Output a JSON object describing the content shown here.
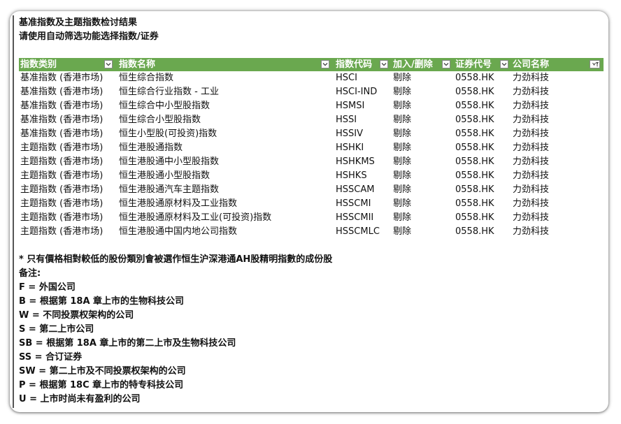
{
  "sheet": {
    "title": "基准指数及主题指数检讨结果",
    "subtitle": "请使用自动筛选功能选择指数/证券"
  },
  "table": {
    "headers": [
      "指数类别",
      "指数名称",
      "指数代码",
      "加入/删除",
      "证券代号",
      "公司名称"
    ],
    "rows": [
      [
        "基准指数 (香港市场)",
        "恒生综合指数",
        "HSCI",
        "剔除",
        "0558.HK",
        "力劲科技"
      ],
      [
        "基准指数 (香港市场)",
        "恒生综合行业指数 - 工业",
        "HSCI-IND",
        "剔除",
        "0558.HK",
        "力劲科技"
      ],
      [
        "基准指数 (香港市场)",
        "恒生综合中小型股指数",
        "HSMSI",
        "剔除",
        "0558.HK",
        "力劲科技"
      ],
      [
        "基准指数 (香港市场)",
        "恒生综合小型股指数",
        "HSSI",
        "剔除",
        "0558.HK",
        "力劲科技"
      ],
      [
        "基准指数 (香港市场)",
        "恒生小型股(可投资)指数",
        "HSSIV",
        "剔除",
        "0558.HK",
        "力劲科技"
      ],
      [
        "主题指数 (香港市场)",
        "恒生港股通指数",
        "HSHKI",
        "剔除",
        "0558.HK",
        "力劲科技"
      ],
      [
        "主题指数 (香港市场)",
        "恒生港股通中小型股指数",
        "HSHKMS",
        "剔除",
        "0558.HK",
        "力劲科技"
      ],
      [
        "主题指数 (香港市场)",
        "恒生港股通小型股指数",
        "HSHKS",
        "剔除",
        "0558.HK",
        "力劲科技"
      ],
      [
        "主题指数 (香港市场)",
        "恒生港股通汽车主题指数",
        "HSSCAM",
        "剔除",
        "0558.HK",
        "力劲科技"
      ],
      [
        "主题指数 (香港市场)",
        "恒生港股通原材料及工业指数",
        "HSSCMI",
        "剔除",
        "0558.HK",
        "力劲科技"
      ],
      [
        "主题指数 (香港市场)",
        "恒生港股通原材料及工业(可投资)指数",
        "HSSCMII",
        "剔除",
        "0558.HK",
        "力劲科技"
      ],
      [
        "主题指数 (香港市场)",
        "恒生港股通中国内地公司指数",
        "HSSCMLC",
        "剔除",
        "0558.HK",
        "力劲科技"
      ]
    ]
  },
  "notes": {
    "footnote": "* 只有價格相對較低的股份類別會被選作恒生沪深港通AH股精明指數的成份股",
    "legend_title": "备注:",
    "items": [
      "F = 外国公司",
      "B = 根据第 18A 章上市的生物科技公司",
      "W = 不同投票权架构的公司",
      "S = 第二上市公司",
      "SB = 根据第 18A 章上市的第二上市及生物科技公司",
      "SS = 合订证券",
      "SW = 第二上市及不同投票权架构的公司",
      "P = 根据第 18C 章上市的特专科技公司",
      "U = 上市时尚未有盈利的公司"
    ]
  },
  "colors": {
    "header_bg": "#6aa84f",
    "header_text": "#ffffff"
  },
  "icons": {
    "filter_dropdown": "chevron-down-icon",
    "filter_active": "filter-applied-icon"
  }
}
